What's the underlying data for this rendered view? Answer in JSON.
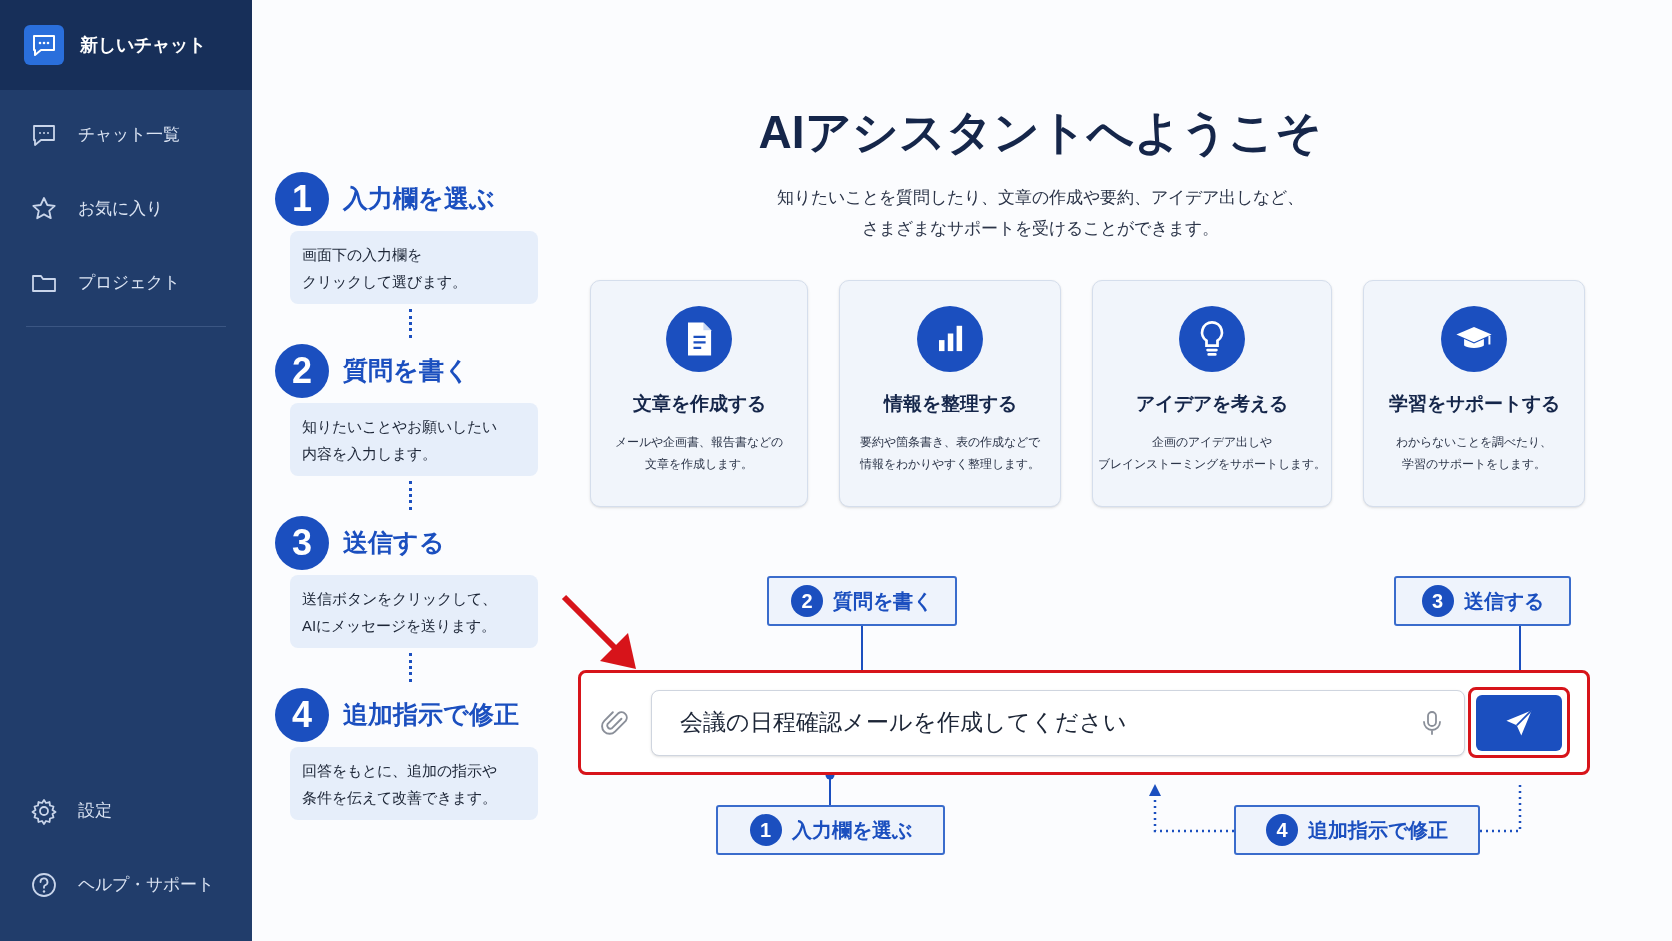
{
  "sidebar": {
    "new_chat": {
      "label": "新しいチャット",
      "selected": true
    },
    "items": [
      {
        "label": "チャット一覧",
        "selected": false
      },
      {
        "label": "お気に入り",
        "selected": false
      },
      {
        "label": "プロジェクト",
        "selected": false
      }
    ],
    "footer_items": [
      {
        "label": "設定"
      },
      {
        "label": "ヘルプ・サポート"
      }
    ]
  },
  "steps": [
    {
      "number": "1",
      "title": "入力欄を選ぶ",
      "lines": [
        "画面下の入力欄を",
        "クリックして選びます。"
      ]
    },
    {
      "number": "2",
      "title": "質問を書く",
      "lines": [
        "知りたいことやお願いしたい",
        "内容を入力します。"
      ]
    },
    {
      "number": "3",
      "title": "送信する",
      "lines": [
        "送信ボタンをクリックして、",
        "AIにメッセージを送ります。"
      ]
    },
    {
      "number": "4",
      "title": "追加指示で修正",
      "lines": [
        "回答をもとに、追加の指示や",
        "条件を伝えて改善できます。"
      ]
    }
  ],
  "welcome": {
    "title": "AIアシスタントへようこそ",
    "subtitle_lines": [
      "知りたいことを質問したり、文章の作成や要約、アイデア出しなど、",
      "さまざまなサポートを受けることができます。"
    ]
  },
  "cards": [
    {
      "title": "文章を作成する",
      "lines": [
        "メールや企画書、報告書などの",
        "文章を作成します。"
      ]
    },
    {
      "title": "情報を整理する",
      "lines": [
        "要約や箇条書き、表の作成などで",
        "情報をわかりやすく整理します。"
      ]
    },
    {
      "title": "アイデアを考える",
      "lines": [
        "企画のアイデア出しや",
        "ブレインストーミングをサポートします。"
      ]
    },
    {
      "title": "学習をサポートする",
      "lines": [
        "わからないことを調べたり、",
        "学習のサポートをします。"
      ]
    }
  ],
  "composer": {
    "value": "会議の日程確認メールを作成してください"
  },
  "callouts": [
    {
      "number": "2",
      "label": "質問を書く"
    },
    {
      "number": "3",
      "label": "送信する"
    },
    {
      "number": "1",
      "label": "入力欄を選ぶ"
    },
    {
      "number": "4",
      "label": "追加指示で修正"
    }
  ]
}
